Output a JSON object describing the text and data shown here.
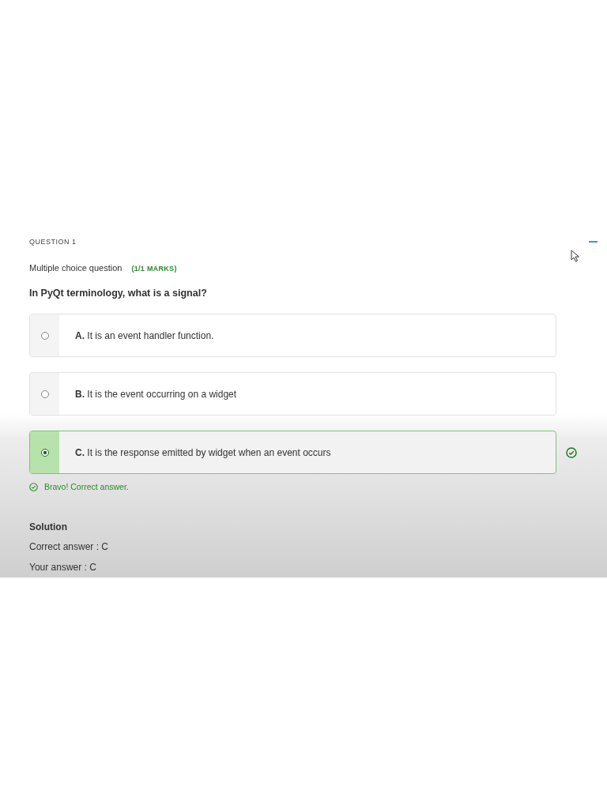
{
  "question": {
    "heading": "QUESTION 1",
    "type": "Multiple choice question",
    "marks": "(1/1 MARKS)",
    "text": "In PyQt terminology, what is a signal?",
    "expanded": true
  },
  "options": [
    {
      "letter": "A.",
      "text": "It is an event handler function.",
      "selected": false,
      "correct": false
    },
    {
      "letter": "B.",
      "text": "It is the event occurring on a widget",
      "selected": false,
      "correct": false
    },
    {
      "letter": "C.",
      "text": "It is the response emitted by widget when an event occurs",
      "selected": true,
      "correct": true
    }
  ],
  "feedback": "Bravo! Correct answer.",
  "solution": {
    "title": "Solution",
    "correct_answer": "Correct answer : C",
    "your_answer": "Your answer : C"
  }
}
